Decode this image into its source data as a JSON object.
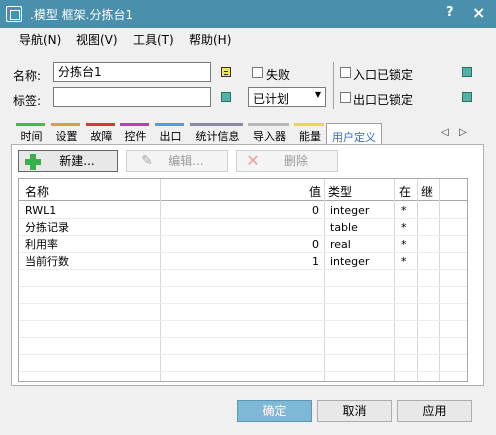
{
  "window": {
    "title": ".模型 框架.分拣台1",
    "help_glyph": "?",
    "close_glyph": "×"
  },
  "menu": [
    "导航(N)",
    "视图(V)",
    "工具(T)",
    "帮助(H)"
  ],
  "form": {
    "name_label": "名称:",
    "name_value": "分拣台1",
    "tag_label": "标签:",
    "tag_value": "",
    "failure_label": "失败",
    "status_value": "已计划",
    "entry_locked_label": "入口已锁定",
    "exit_locked_label": "出口已锁定"
  },
  "tabs": [
    {
      "label": "时间",
      "color": "#3fbf3f"
    },
    {
      "label": "设置",
      "color": "#d8a040"
    },
    {
      "label": "故障",
      "color": "#d23a3a"
    },
    {
      "label": "控件",
      "color": "#c03ac0"
    },
    {
      "label": "出口",
      "color": "#4aa0e0"
    },
    {
      "label": "统计信息",
      "color": "#8a8aa8"
    },
    {
      "label": "导入器",
      "color": "#b8b8b8"
    },
    {
      "label": "能量",
      "color": "#e8d84a"
    },
    {
      "label": "用户定义",
      "color": "",
      "active": true
    }
  ],
  "tab_nav": {
    "prev": "◁",
    "next": "▷"
  },
  "toolbar": {
    "new_label": "新建...",
    "edit_label": "编辑...",
    "delete_label": "删除"
  },
  "table": {
    "columns": [
      "名称",
      "值",
      "类型",
      "在",
      "继"
    ],
    "rows": [
      {
        "name": "RWL1",
        "value": "0",
        "type": "integer",
        "in": "*",
        "inherit": ""
      },
      {
        "name": "分拣记录",
        "value": "",
        "type": "table",
        "in": "*",
        "inherit": ""
      },
      {
        "name": "利用率",
        "value": "0",
        "type": "real",
        "in": "*",
        "inherit": ""
      },
      {
        "name": "当前行数",
        "value": "1",
        "type": "integer",
        "in": "*",
        "inherit": ""
      }
    ]
  },
  "footer": {
    "ok_label": "确定",
    "cancel_label": "取消",
    "apply_label": "应用"
  },
  "colors": {
    "titlebar": "#4a90ad",
    "ok_button": "#7fb8d6",
    "active_tab_text": "#2b6fbf"
  }
}
